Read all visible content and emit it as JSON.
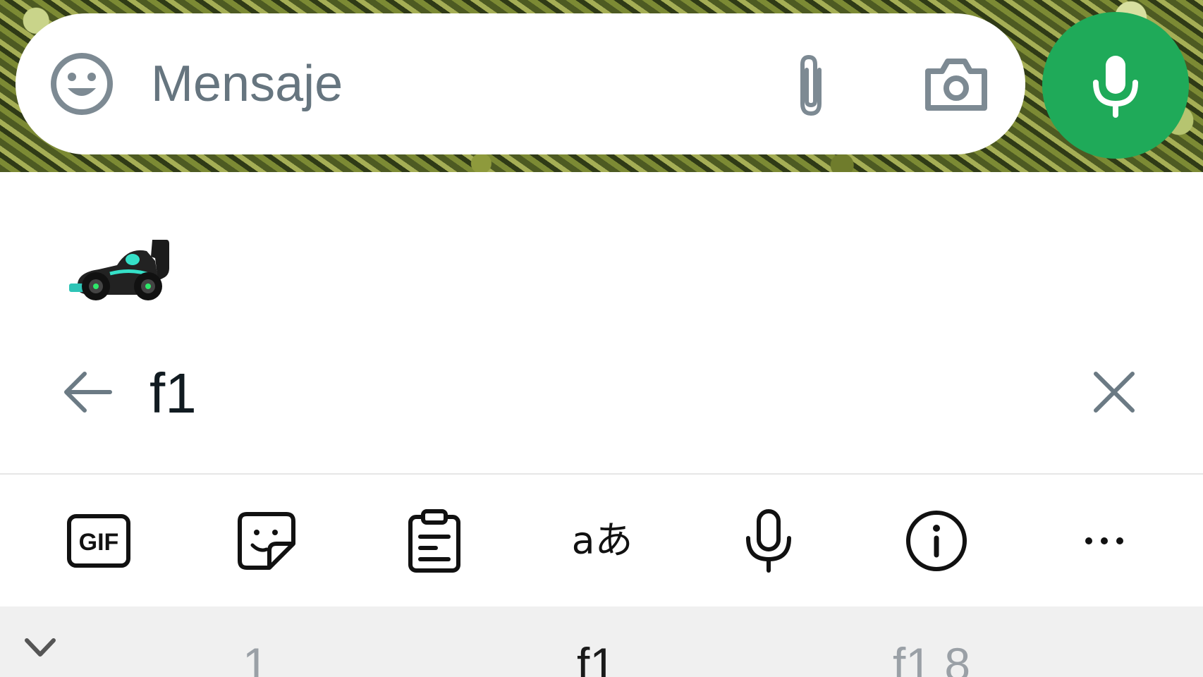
{
  "composer": {
    "placeholder": "Mensaje",
    "emoji_icon": "smiley-icon",
    "attach_icon": "paperclip-icon",
    "camera_icon": "camera-icon",
    "mic_icon": "microphone-icon",
    "accent_color": "#1faa59"
  },
  "emoji_results": [
    {
      "icon": "racing-car-emoji"
    }
  ],
  "search": {
    "query": "f1",
    "back_icon": "arrow-left-icon",
    "clear_icon": "close-icon"
  },
  "toolbar": {
    "items": [
      {
        "icon": "gif-icon",
        "label": "GIF"
      },
      {
        "icon": "sticker-icon"
      },
      {
        "icon": "clipboard-icon"
      },
      {
        "icon": "translate-icon",
        "label": "aあ"
      },
      {
        "icon": "microphone-icon"
      },
      {
        "icon": "info-icon"
      },
      {
        "icon": "more-icon"
      }
    ]
  },
  "suggestions": {
    "collapse_icon": "chevron-down-icon",
    "items": [
      "1",
      "f1",
      "f1 8"
    ]
  }
}
